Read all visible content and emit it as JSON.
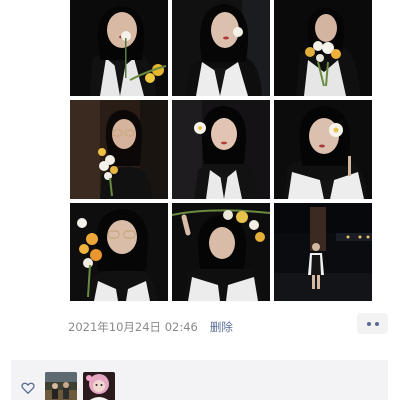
{
  "post": {
    "timestamp": "2021年10月24日 02:46",
    "delete_label": "删除"
  },
  "photos": [
    {
      "name": "photo-1",
      "description": "girl with white flower at mouth, yellow flowers"
    },
    {
      "name": "photo-2",
      "description": "girl with flower at lips"
    },
    {
      "name": "photo-3",
      "description": "girl holding bouquet"
    },
    {
      "name": "photo-4",
      "description": "girl with glasses holding flowers"
    },
    {
      "name": "photo-5",
      "description": "girl with flower in hair"
    },
    {
      "name": "photo-6",
      "description": "girl covering eye with flower"
    },
    {
      "name": "photo-7",
      "description": "girl with glasses and orange flowers"
    },
    {
      "name": "photo-8",
      "description": "girl holding flower stem above head"
    },
    {
      "name": "photo-9",
      "description": "full body at night by water"
    }
  ],
  "likes": {
    "icon": "heart-outline-icon",
    "avatars": [
      "avatar-1",
      "avatar-2"
    ]
  },
  "colors": {
    "link": "#576b95",
    "timestamp": "#8a8a8a",
    "likes_bg": "#f3f3f5"
  }
}
